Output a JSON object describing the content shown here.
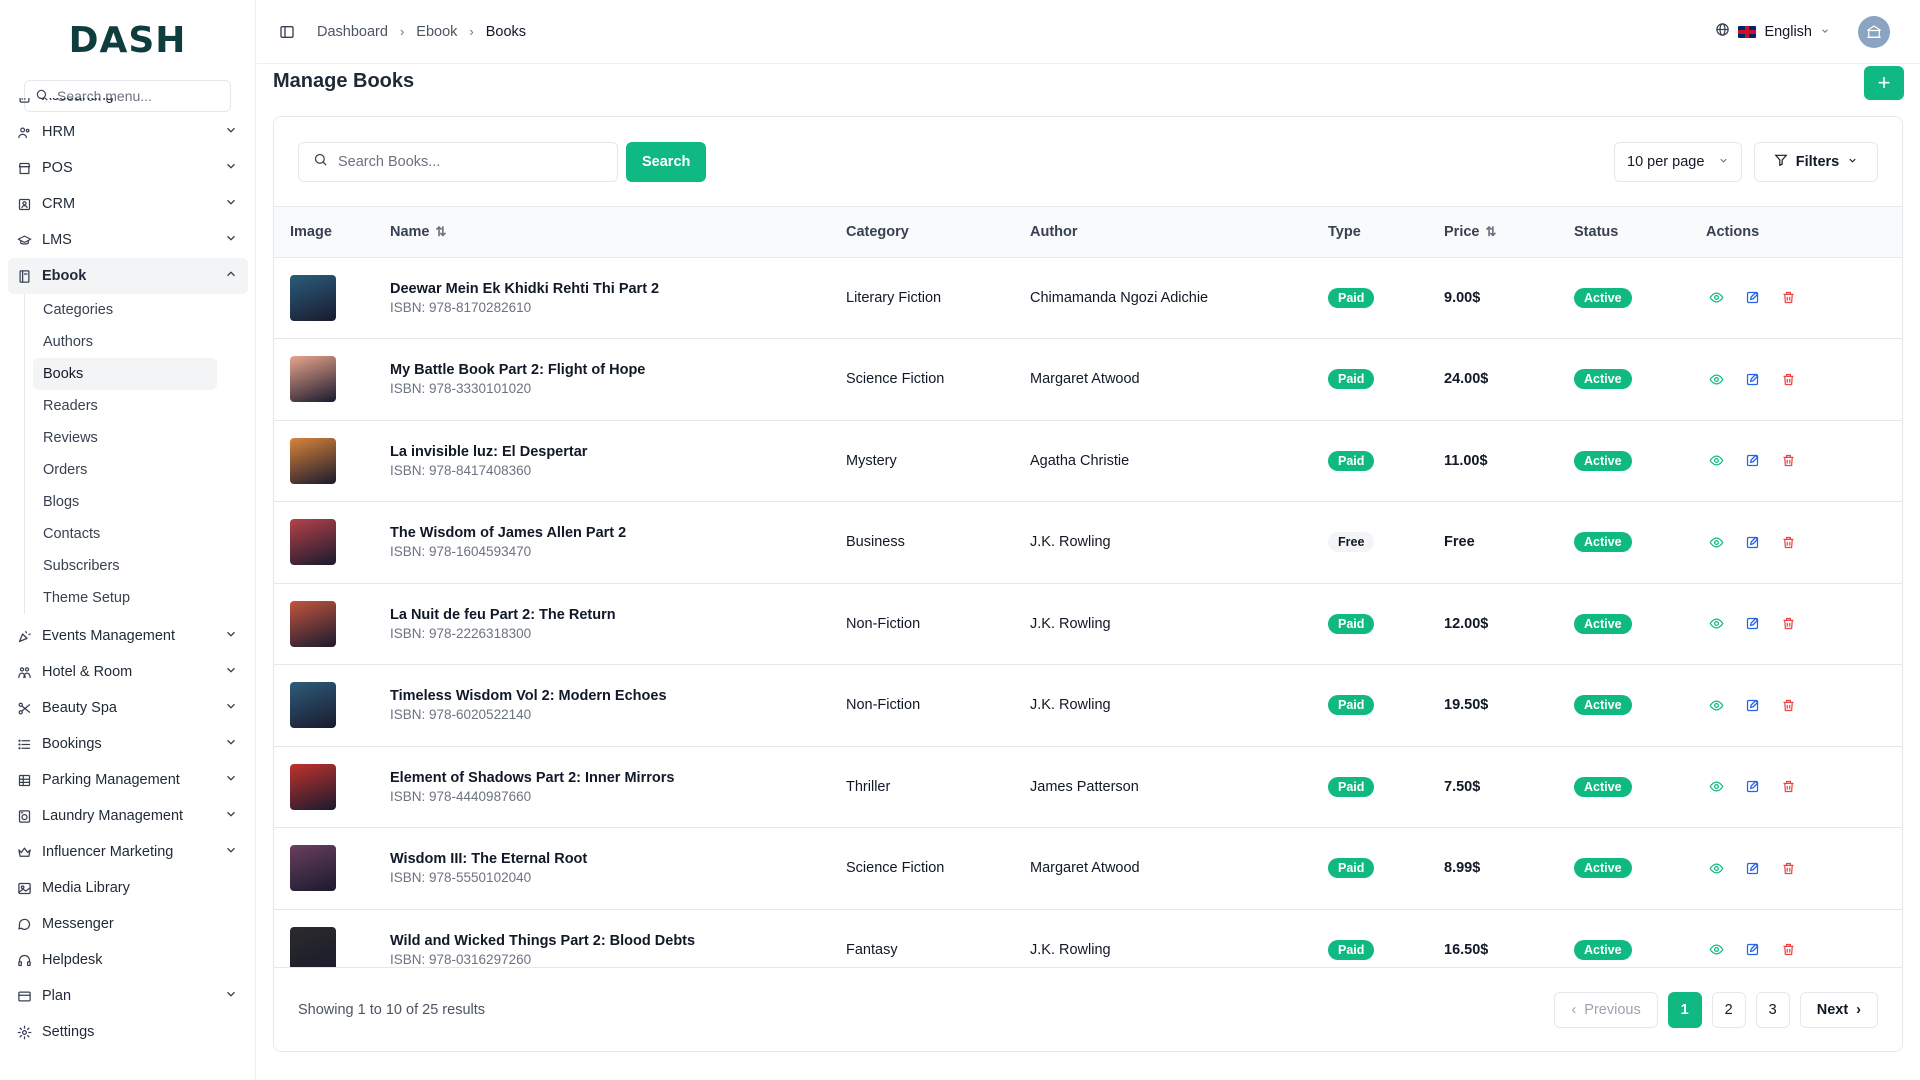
{
  "app": {
    "logo": "DASH"
  },
  "sidebar": {
    "search_placeholder": "Search menu...",
    "items": [
      {
        "label": "Accounting",
        "icon": "calculator-icon",
        "chevron": true
      },
      {
        "label": "HRM",
        "icon": "users-icon",
        "chevron": true
      },
      {
        "label": "POS",
        "icon": "store-icon",
        "chevron": true
      },
      {
        "label": "CRM",
        "icon": "contact-icon",
        "chevron": true
      },
      {
        "label": "LMS",
        "icon": "graduation-cap-icon",
        "chevron": true
      },
      {
        "label": "Ebook",
        "icon": "book-icon",
        "chevron": true,
        "expanded": true
      }
    ],
    "ebook_sub": [
      "Categories",
      "Authors",
      "Books",
      "Readers",
      "Reviews",
      "Orders",
      "Blogs",
      "Contacts",
      "Subscribers",
      "Theme Setup"
    ],
    "active_sub": "Books",
    "items_after": [
      {
        "label": "Events Management",
        "icon": "party-icon",
        "chevron": true
      },
      {
        "label": "Hotel & Room",
        "icon": "hotel-icon",
        "chevron": true
      },
      {
        "label": "Beauty Spa",
        "icon": "scissors-icon",
        "chevron": true
      },
      {
        "label": "Bookings",
        "icon": "list-icon",
        "chevron": true
      },
      {
        "label": "Parking Management",
        "icon": "grid-icon",
        "chevron": true
      },
      {
        "label": "Laundry Management",
        "icon": "washer-icon",
        "chevron": true
      },
      {
        "label": "Influencer Marketing",
        "icon": "crown-icon",
        "chevron": true
      },
      {
        "label": "Media Library",
        "icon": "image-icon",
        "chevron": false
      },
      {
        "label": "Messenger",
        "icon": "message-icon",
        "chevron": false
      },
      {
        "label": "Helpdesk",
        "icon": "headset-icon",
        "chevron": false
      },
      {
        "label": "Plan",
        "icon": "card-icon",
        "chevron": true
      },
      {
        "label": "Settings",
        "icon": "gear-icon",
        "chevron": false
      }
    ]
  },
  "topbar": {
    "breadcrumbs": [
      "Dashboard",
      "Ebook",
      "Books"
    ],
    "language": "English"
  },
  "page": {
    "title": "Manage Books",
    "add_label": "+"
  },
  "toolbar": {
    "search_placeholder": "Search Books...",
    "search_button": "Search",
    "per_page": "10 per page",
    "filters": "Filters"
  },
  "table": {
    "headers": {
      "image": "Image",
      "name": "Name",
      "category": "Category",
      "author": "Author",
      "type": "Type",
      "price": "Price",
      "status": "Status",
      "actions": "Actions"
    },
    "rows": [
      {
        "name": "Deewar Mein Ek Khidki Rehti Thi Part 2",
        "isbn": "ISBN: 978-8170282610",
        "category": "Literary Fiction",
        "author": "Chimamanda Ngozi Adichie",
        "type": "Paid",
        "price": "9.00$",
        "status": "Active",
        "cover": "#2a5d7c"
      },
      {
        "name": "My Battle Book Part 2: Flight of Hope",
        "isbn": "ISBN: 978-3330101020",
        "category": "Science Fiction",
        "author": "Margaret Atwood",
        "type": "Paid",
        "price": "24.00$",
        "status": "Active",
        "cover": "#e8a58c"
      },
      {
        "name": "La invisible luz: El Despertar",
        "isbn": "ISBN: 978-8417408360",
        "category": "Mystery",
        "author": "Agatha Christie",
        "type": "Paid",
        "price": "11.00$",
        "status": "Active",
        "cover": "#d9843a"
      },
      {
        "name": "The Wisdom of James Allen Part 2",
        "isbn": "ISBN: 978-1604593470",
        "category": "Business",
        "author": "J.K. Rowling",
        "type": "Free",
        "price": "Free",
        "status": "Active",
        "cover": "#b5424a"
      },
      {
        "name": "La Nuit de feu Part 2: The Return",
        "isbn": "ISBN: 978-2226318300",
        "category": "Non-Fiction",
        "author": "J.K. Rowling",
        "type": "Paid",
        "price": "12.00$",
        "status": "Active",
        "cover": "#c2553e"
      },
      {
        "name": "Timeless Wisdom Vol 2: Modern Echoes",
        "isbn": "ISBN: 978-6020522140",
        "category": "Non-Fiction",
        "author": "J.K. Rowling",
        "type": "Paid",
        "price": "19.50$",
        "status": "Active",
        "cover": "#2e5c7a"
      },
      {
        "name": "Element of Shadows Part 2: Inner Mirrors",
        "isbn": "ISBN: 978-4440987660",
        "category": "Thriller",
        "author": "James Patterson",
        "type": "Paid",
        "price": "7.50$",
        "status": "Active",
        "cover": "#c0322e"
      },
      {
        "name": "Wisdom III: The Eternal Root",
        "isbn": "ISBN: 978-5550102040",
        "category": "Science Fiction",
        "author": "Margaret Atwood",
        "type": "Paid",
        "price": "8.99$",
        "status": "Active",
        "cover": "#6a3f5e"
      },
      {
        "name": "Wild and Wicked Things Part 2: Blood Debts",
        "isbn": "ISBN: 978-0316297260",
        "category": "Fantasy",
        "author": "J.K. Rowling",
        "type": "Paid",
        "price": "16.50$",
        "status": "Active",
        "cover": "#2b2b2b"
      }
    ]
  },
  "footer": {
    "showing": "Showing 1 to 10 of 25 results",
    "previous": "Previous",
    "pages": [
      "1",
      "2",
      "3"
    ],
    "current_page": "1",
    "next": "Next"
  },
  "colors": {
    "accent": "#10b981",
    "danger": "#ef4444",
    "edit": "#2563eb"
  }
}
